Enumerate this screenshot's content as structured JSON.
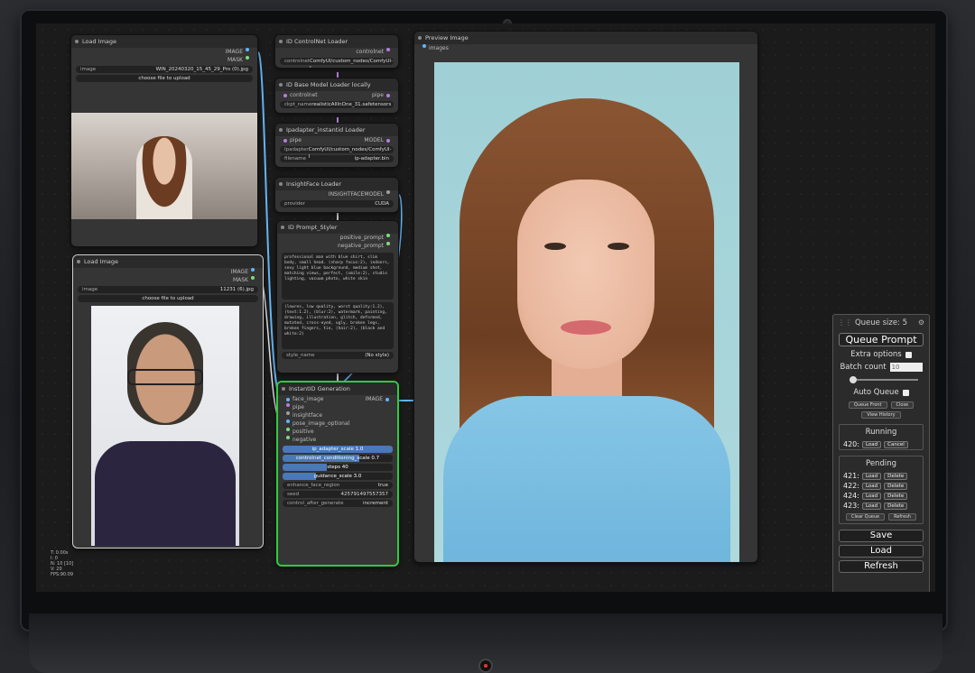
{
  "nodes": {
    "load_image_1": {
      "title": "Load Image",
      "out1": "IMAGE",
      "out2": "MASK",
      "image_label": "image",
      "image_value": "WIN_20240320_15_45_29_Pro (0).jpg",
      "upload": "choose file to upload"
    },
    "load_image_2": {
      "title": "Load Image",
      "out1": "IMAGE",
      "out2": "MASK",
      "image_label": "image",
      "image_value": "11231 (6).jpg",
      "upload": "choose file to upload"
    },
    "controlnet_loader": {
      "title": "ID ControlNet Loader",
      "out": "controlnet",
      "widget_label": "controlnet",
      "widget_value": "ComfyUI/custom_nodes/ComfyUI-I"
    },
    "base_model_loader": {
      "title": "ID Base Model Loader locally",
      "in": "controlnet",
      "out": "pipe",
      "widget_label": "ckpt_name",
      "widget_value": "realisticAllInOne_31.safetensors"
    },
    "ipadapter_loader": {
      "title": "Ipadapter_instantid Loader",
      "in": "pipe",
      "out": "MODEL",
      "w1_label": "Ipadapter",
      "w1_value": "ComfyUI/custom_nodes/ComfyUI-I",
      "w2_label": "filename",
      "w2_value": "ip-adapter.bin"
    },
    "insightface_loader": {
      "title": "InsightFace Loader",
      "out": "INSIGHTFACEMODEL",
      "widget_label": "provider",
      "widget_value": "CUDA"
    },
    "prompt_styler": {
      "title": "ID Prompt_Styler",
      "out1": "positive_prompt",
      "out2": "negative_prompt",
      "positive_text": "professional man with blue shirt, slim body, small head. (sharp focus:2), indoors, sexy light blue background, medium shot, matching views, perfect, (smile:2), studio lighting, vacuum photo, white skin",
      "negative_text": "(lowres, low quality, worst quality:1.2), (text:1.2), (blur:2), watermark, painting, drawing, illustration, glitch, deformed, mutated, cross-eyed, ugly, broken legs, broken fingers, tie, (hair:2), (black and white:2)",
      "style_label": "style_name",
      "style_value": "(No style)"
    },
    "instantid_generation": {
      "title": "InstantID Generation",
      "inputs": [
        "face_image",
        "pipe",
        "insightface",
        "pose_image_optional",
        "positive",
        "negative"
      ],
      "out": "IMAGE",
      "sliders": [
        {
          "label": "ip_adapter_scale",
          "value": "1.0",
          "fraction": 1.0
        },
        {
          "label": "controlnet_conditioning_scale",
          "value": "0.7",
          "fraction": 0.7
        },
        {
          "label": "steps",
          "value": "40",
          "fraction": 0.4
        },
        {
          "label": "guidance_scale",
          "value": "3.0",
          "fraction": 0.3
        }
      ],
      "toggle_label": "enhance_face_region",
      "toggle_value": "true",
      "seed_label": "seed",
      "seed_value": "425791497557357",
      "cag_label": "control_after_generate",
      "cag_value": "increment"
    },
    "preview_image": {
      "title": "Preview Image",
      "in": "images"
    }
  },
  "queue": {
    "size_label": "Queue size: 5",
    "queue_prompt": "Queue Prompt",
    "extra_options": "Extra options",
    "batch_count_label": "Batch count",
    "batch_count_value": "10",
    "auto_queue": "Auto Queue",
    "queue_front": "Queue Front",
    "close": "Close",
    "view_history": "View History",
    "running_label": "Running",
    "running": [
      {
        "id": "420:",
        "b1": "Load",
        "b2": "Cancel"
      }
    ],
    "pending_label": "Pending",
    "pending": [
      {
        "id": "421:",
        "b1": "Load",
        "b2": "Delete"
      },
      {
        "id": "422:",
        "b1": "Load",
        "b2": "Delete"
      },
      {
        "id": "424:",
        "b1": "Load",
        "b2": "Delete"
      },
      {
        "id": "423:",
        "b1": "Load",
        "b2": "Delete"
      }
    ],
    "clear_queue": "Clear Queue",
    "refresh_small": "Refresh",
    "save": "Save",
    "load": "Load",
    "refresh": "Refresh"
  },
  "stats": [
    "T: 0.00s",
    "I: 0",
    "N: 10 [10]",
    "V: 20",
    "FPS:90.09"
  ]
}
